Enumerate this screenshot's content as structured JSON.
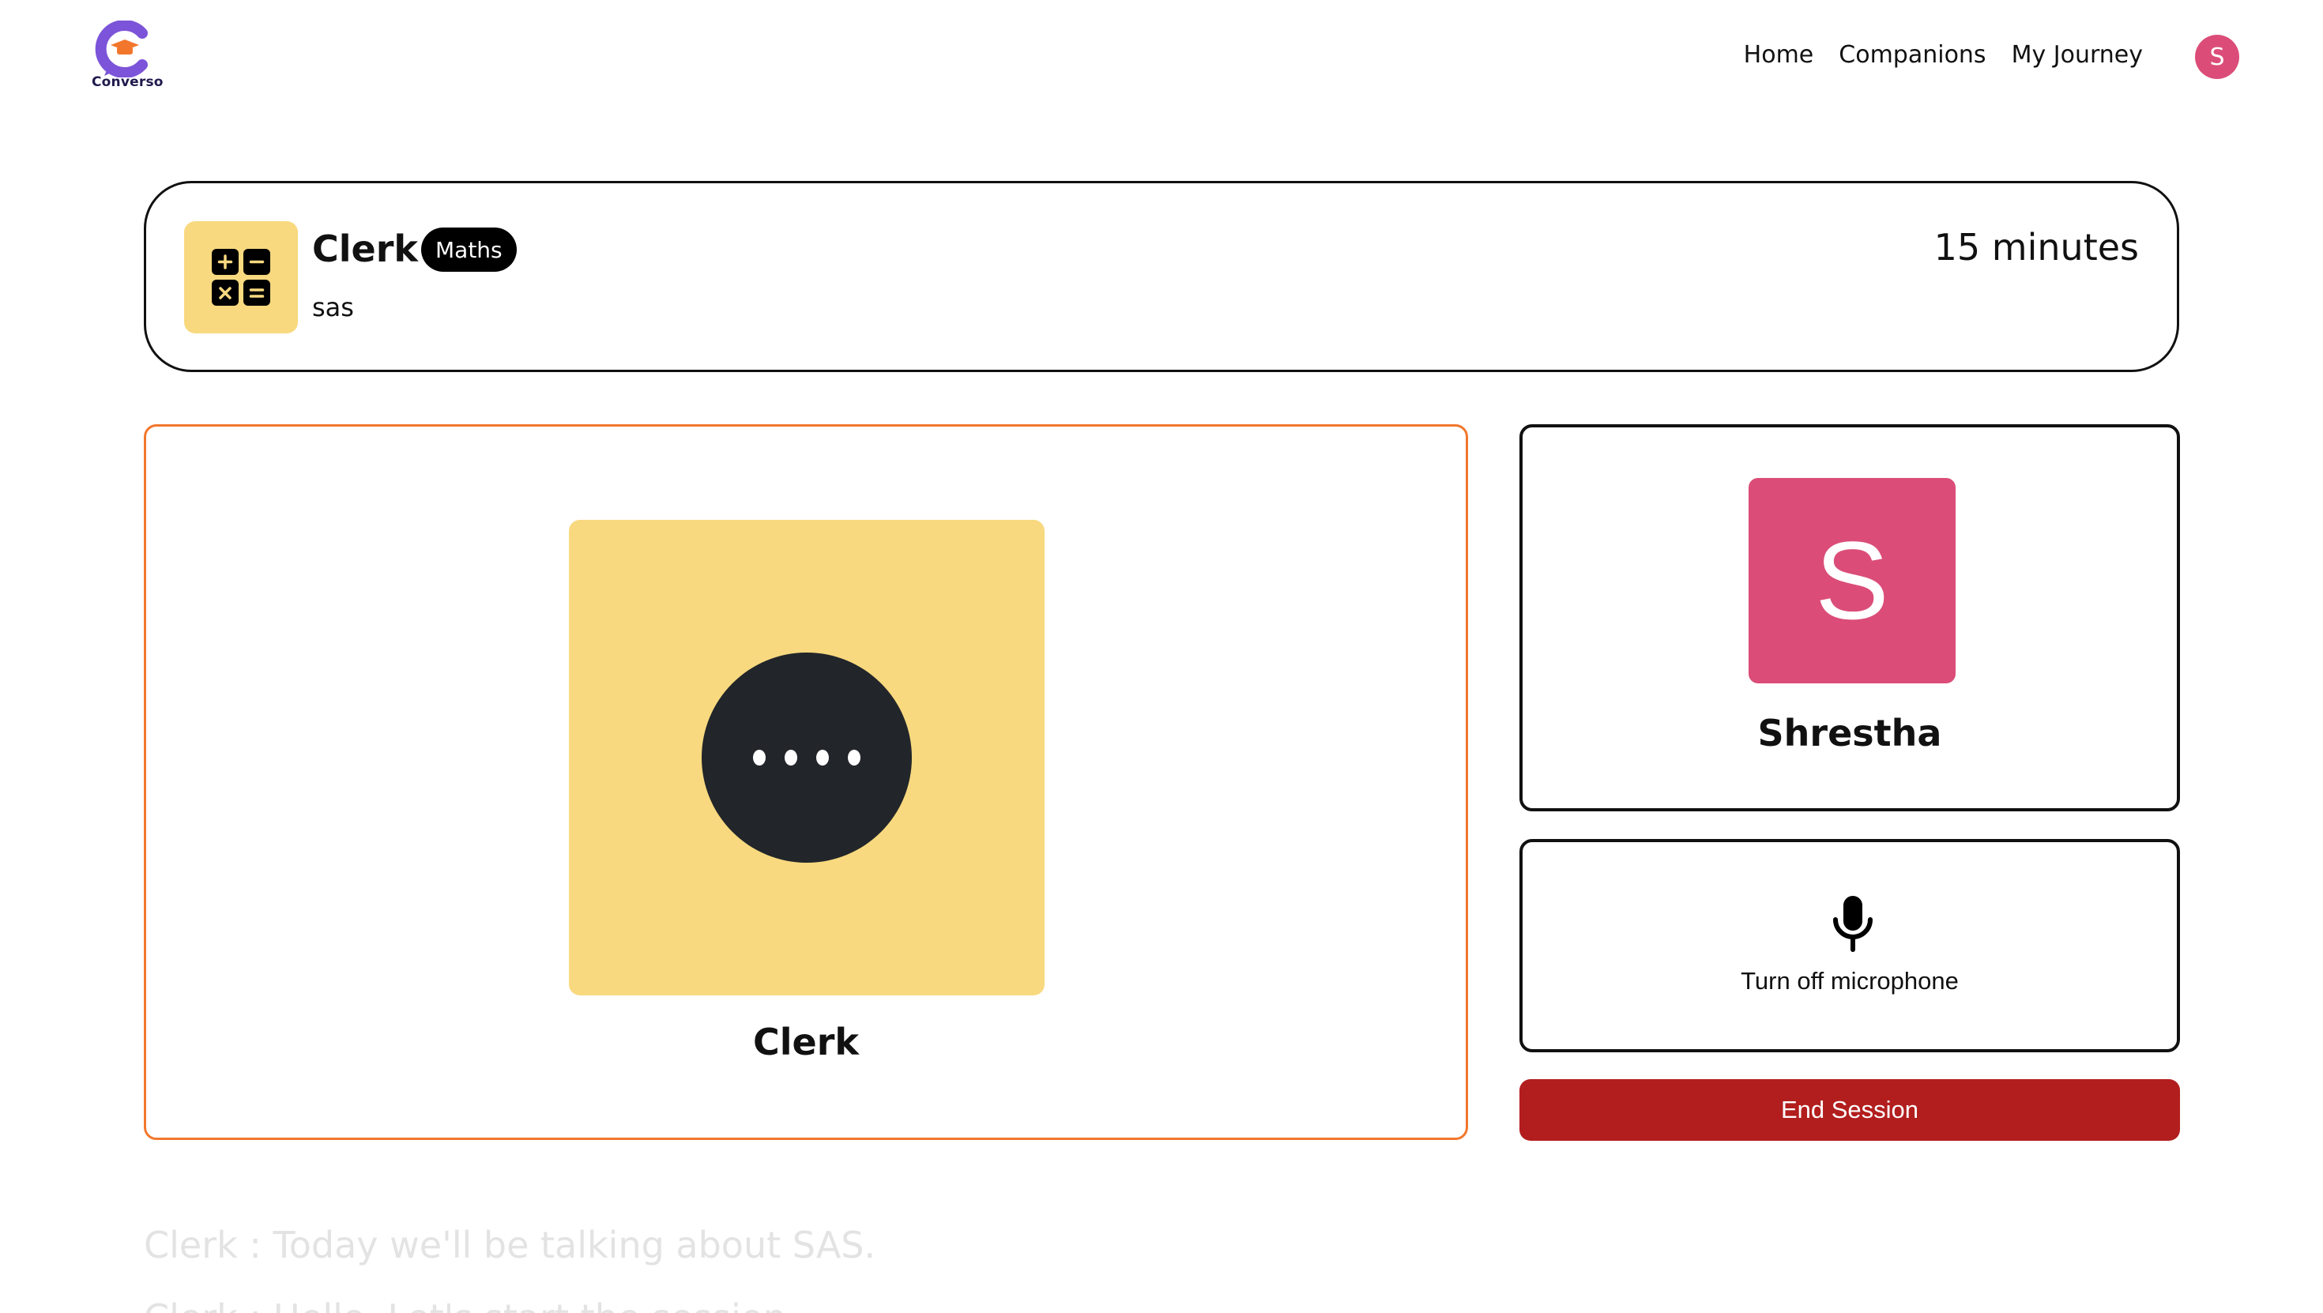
{
  "brand": {
    "name": "Converso",
    "logo_icon": "graduation-chat-logo",
    "accent": "#7c54d9"
  },
  "nav": {
    "links": [
      {
        "label": "Home"
      },
      {
        "label": "Companions"
      },
      {
        "label": "My Journey"
      }
    ],
    "avatar_initial": "S"
  },
  "companion": {
    "name": "Clerk",
    "subject": "Maths",
    "topic": "sas",
    "duration": "15 minutes",
    "subject_icon": "calculator-icon",
    "icon_bg": "#f8d97f",
    "panel_border": "#f2772d",
    "status": "speaking"
  },
  "user": {
    "initial": "S",
    "name": "Shrestha",
    "avatar_bg": "#db4d78"
  },
  "controls": {
    "mic_label": "Turn off microphone",
    "mic_icon": "microphone-icon",
    "end_label": "End Session",
    "end_color": "#b21e1e"
  },
  "transcript": {
    "messages": [
      {
        "text": "Clerk : Today we'll be talking about SAS."
      },
      {
        "text": "Clerk : Hello. Let's start the session."
      }
    ]
  }
}
